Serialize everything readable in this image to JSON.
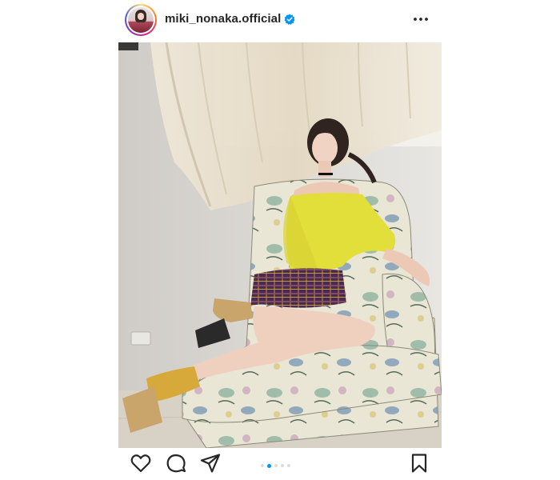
{
  "post": {
    "username": "miki_nonaka.official",
    "verified": true,
    "more_icon": "more-horizontal-icon",
    "photo_alt": "",
    "carousel": {
      "total": 5,
      "current": 1
    },
    "actions": [
      "heart-icon",
      "comment-icon",
      "share-icon",
      "bookmark-icon"
    ]
  },
  "colors": {
    "accent": "#0095f6",
    "text": "#262626"
  }
}
